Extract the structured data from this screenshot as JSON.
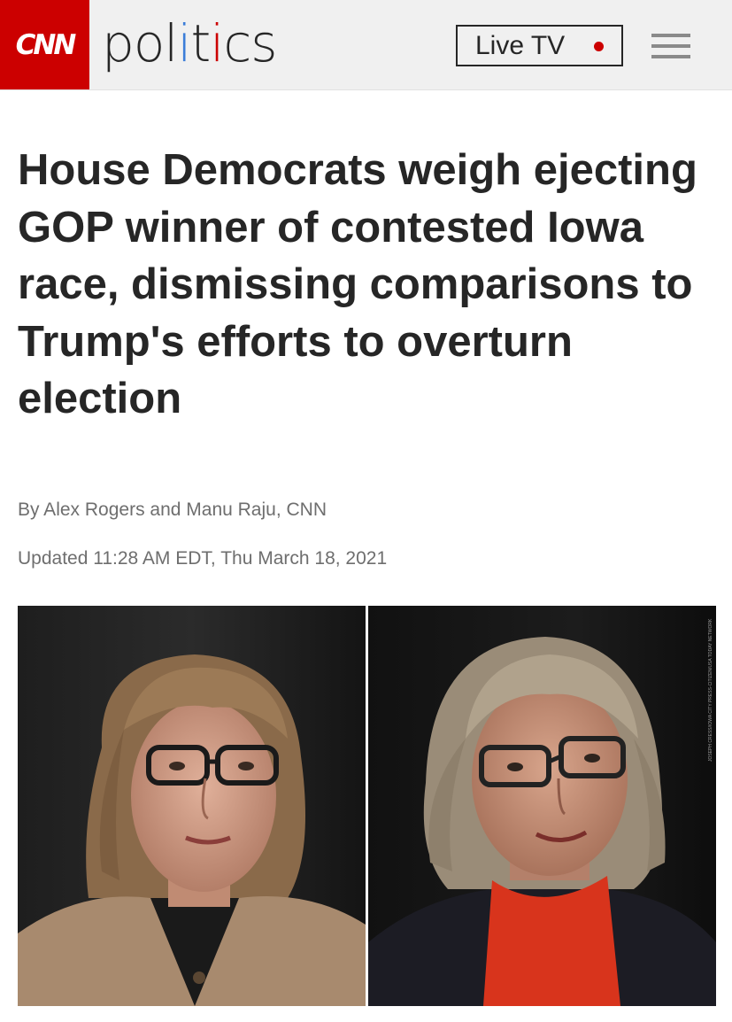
{
  "header": {
    "logo": "CNN",
    "section": "politics",
    "live_tv_label": "Live TV",
    "brand_color": "#cc0000"
  },
  "article": {
    "headline": "House Democrats weigh ejecting GOP winner of contested Iowa race, dismissing comparisons to Trump's efforts to overturn election",
    "byline": "By Alex Rogers and Manu Raju, CNN",
    "updated": "Updated 11:28 AM EDT, Thu March 18, 2021"
  },
  "photos": [
    {
      "subject": "woman with shoulder-length light brown hair, dark-framed glasses, tan cardigan"
    },
    {
      "subject": "woman with gray-blonde bob, dark-framed glasses, red turtleneck, dark jacket"
    }
  ],
  "photo_credit": "JOSEPH CRESS/IOWA CITY PRESS-CITIZEN/USA TODAY NETWORK"
}
